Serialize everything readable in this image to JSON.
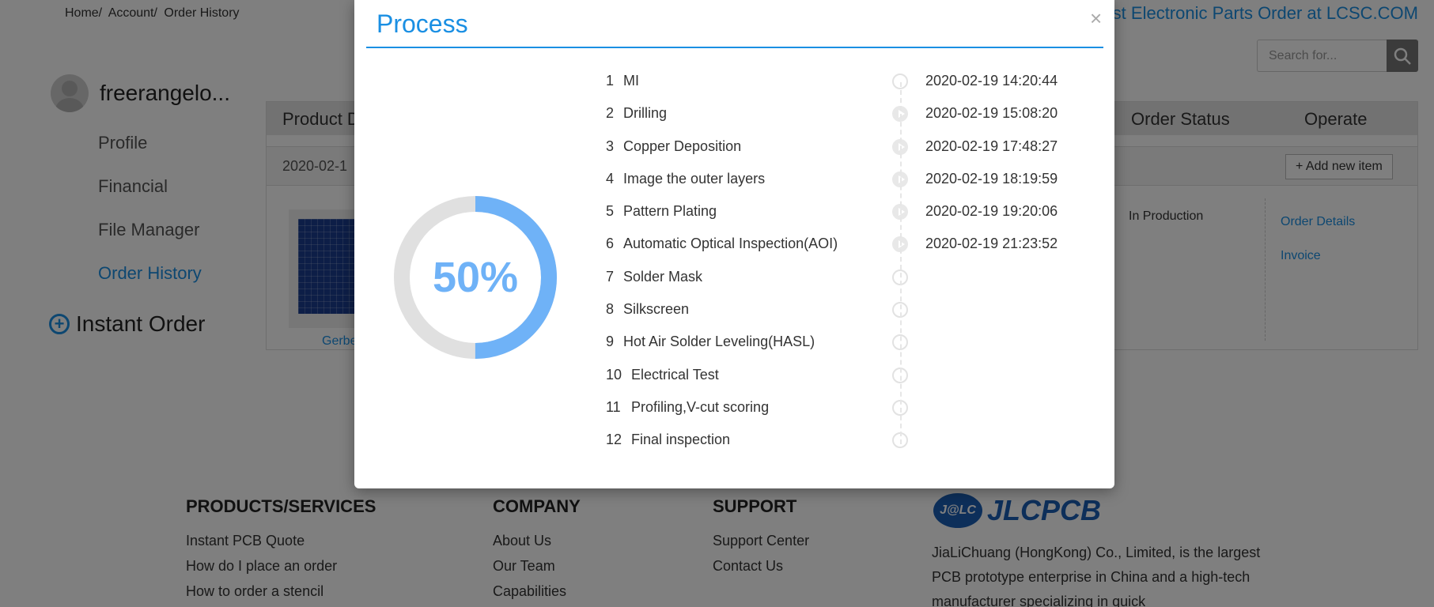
{
  "breadcrumb": [
    "Home/",
    "Account/",
    "Order History"
  ],
  "promo_text": "st Electronic Parts Order at LCSC.COM",
  "search": {
    "placeholder": "Search for...",
    "icon": "search-icon"
  },
  "user": {
    "name": "freerangelo..."
  },
  "sidebar": {
    "items": [
      {
        "label": "Profile",
        "active": false
      },
      {
        "label": "Financial",
        "active": false
      },
      {
        "label": "File Manager",
        "active": false
      },
      {
        "label": "Order History",
        "active": true
      }
    ],
    "instant_order": "Instant Order"
  },
  "orders": {
    "headers": {
      "product": "Product D",
      "status": "Order Status",
      "operate": "Operate"
    },
    "row_date": "2020-02-1",
    "add_new_item": "+ Add new item",
    "gerber_label": "Gerbe",
    "status_value": "In Production",
    "links": {
      "details": "Order Details",
      "invoice": "Invoice"
    }
  },
  "footer": {
    "products": {
      "title": "PRODUCTS/SERVICES",
      "links": [
        "Instant PCB Quote",
        "How do I place an order",
        "How to order a stencil"
      ]
    },
    "company": {
      "title": "COMPANY",
      "links": [
        "About Us",
        "Our Team",
        "Capabilities"
      ]
    },
    "support": {
      "title": "SUPPORT",
      "links": [
        "Support Center",
        "Contact Us"
      ]
    },
    "brand": {
      "badge": "J@LC",
      "name": "JLCPCB"
    },
    "description": "JiaLiChuang (HongKong) Co., Limited, is the largest PCB prototype enterprise in China and a high-tech manufacturer specializing in quick"
  },
  "modal": {
    "title": "Process",
    "close": "×",
    "progress_text": "50%",
    "progress_fraction": 0.5,
    "colors": {
      "accent": "#1a8fe3",
      "progress": "#6fb2f7",
      "track": "#e0e0e0"
    },
    "steps": [
      {
        "num": "1",
        "name": "MI",
        "time": "2020-02-19 14:20:44"
      },
      {
        "num": "2",
        "name": "Drilling",
        "time": "2020-02-19 15:08:20"
      },
      {
        "num": "3",
        "name": "Copper Deposition",
        "time": "2020-02-19 17:48:27"
      },
      {
        "num": "4",
        "name": "Image the outer layers",
        "time": "2020-02-19 18:19:59"
      },
      {
        "num": "5",
        "name": "Pattern Plating",
        "time": "2020-02-19 19:20:06"
      },
      {
        "num": "6",
        "name": "Automatic Optical Inspection(AOI)",
        "time": "2020-02-19 21:23:52"
      },
      {
        "num": "7",
        "name": "Solder Mask",
        "time": ""
      },
      {
        "num": "8",
        "name": "Silkscreen",
        "time": ""
      },
      {
        "num": "9",
        "name": "Hot Air Solder Leveling(HASL)",
        "time": ""
      },
      {
        "num": "10",
        "name": "Electrical Test",
        "time": ""
      },
      {
        "num": "11",
        "name": "Profiling,V-cut scoring",
        "time": ""
      },
      {
        "num": "12",
        "name": "Final inspection",
        "time": ""
      }
    ]
  }
}
